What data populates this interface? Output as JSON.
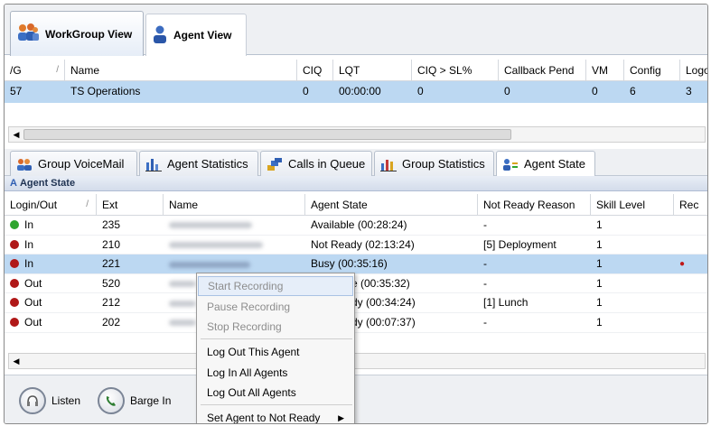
{
  "top_tabs": [
    {
      "label": "WorkGroup View"
    },
    {
      "label": "Agent View"
    }
  ],
  "workgroup_table": {
    "columns": [
      "/G",
      "Name",
      "CIQ",
      "LQT",
      "CIQ > SL%",
      "Callback Pend",
      "VM",
      "Config",
      "Logo"
    ],
    "rows": [
      [
        "57",
        "TS Operations",
        "0",
        "00:00:00",
        "0",
        "0",
        "0",
        "6",
        "3"
      ]
    ]
  },
  "bottom_tabs": [
    {
      "label": "Group VoiceMail"
    },
    {
      "label": "Agent Statistics"
    },
    {
      "label": "Calls in Queue"
    },
    {
      "label": "Group Statistics"
    },
    {
      "label": "Agent State"
    }
  ],
  "section_title": "Agent State",
  "agent_table": {
    "columns": [
      "Login/Out",
      "Ext",
      "Name",
      "Agent State",
      "Not Ready Reason",
      "Skill Level",
      "Rec"
    ],
    "rows": [
      {
        "login": "In",
        "status_color": "#2ea52e",
        "ext": "235",
        "state": "Available (00:28:24)",
        "reason": "-",
        "skill": "1",
        "rec": ""
      },
      {
        "login": "In",
        "status_color": "#b01818",
        "ext": "210",
        "state": "Not Ready (02:13:24)",
        "reason": "[5] Deployment",
        "skill": "1",
        "rec": ""
      },
      {
        "login": "In",
        "status_color": "#b01818",
        "ext": "221",
        "state": "Busy (00:35:16)",
        "reason": "-",
        "skill": "1",
        "rec": "●"
      },
      {
        "login": "Out",
        "status_color": "#b01818",
        "ext": "520",
        "state": "e (00:35:32)",
        "reason": "-",
        "skill": "1",
        "rec": ""
      },
      {
        "login": "Out",
        "status_color": "#b01818",
        "ext": "212",
        "state": "dy (00:34:24)",
        "reason": "[1] Lunch",
        "skill": "1",
        "rec": ""
      },
      {
        "login": "Out",
        "status_color": "#b01818",
        "ext": "202",
        "state": "dy (00:07:37)",
        "reason": "-",
        "skill": "1",
        "rec": ""
      }
    ]
  },
  "context_menu": {
    "items": [
      {
        "label": "Start Recording",
        "disabled": true
      },
      {
        "label": "Pause Recording",
        "disabled": true
      },
      {
        "label": "Stop Recording",
        "disabled": true
      },
      {
        "label": "Log Out This Agent",
        "disabled": false
      },
      {
        "label": "Log In All Agents",
        "disabled": false
      },
      {
        "label": "Log Out All Agents",
        "disabled": false
      },
      {
        "label": "Set Agent to Not Ready",
        "disabled": false,
        "submenu": "▶"
      }
    ]
  },
  "bottom_buttons": [
    {
      "label": "Listen"
    },
    {
      "label": "Barge In"
    }
  ],
  "colors": {
    "selected_row": "#bcd8f2",
    "status_in_available": "#2ea52e",
    "status_red": "#b01818"
  }
}
